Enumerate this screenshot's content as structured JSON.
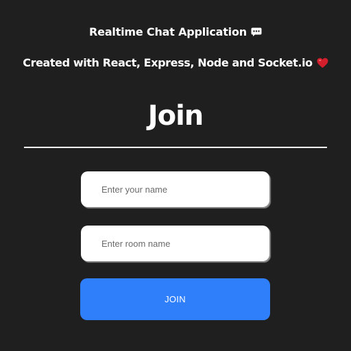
{
  "header": {
    "title": "Realtime Chat Application",
    "title_icon": "speech-bubble-icon",
    "subtitle": "Created with React, Express, Node and Socket.io",
    "subtitle_icon": "heart-icon"
  },
  "form": {
    "heading": "Join",
    "name_placeholder": "Enter your name",
    "room_placeholder": "Enter room name",
    "join_label": "JOIN"
  },
  "colors": {
    "background": "#1f1f20",
    "accent": "#2f7ffb",
    "heart": "#d21f2b"
  }
}
